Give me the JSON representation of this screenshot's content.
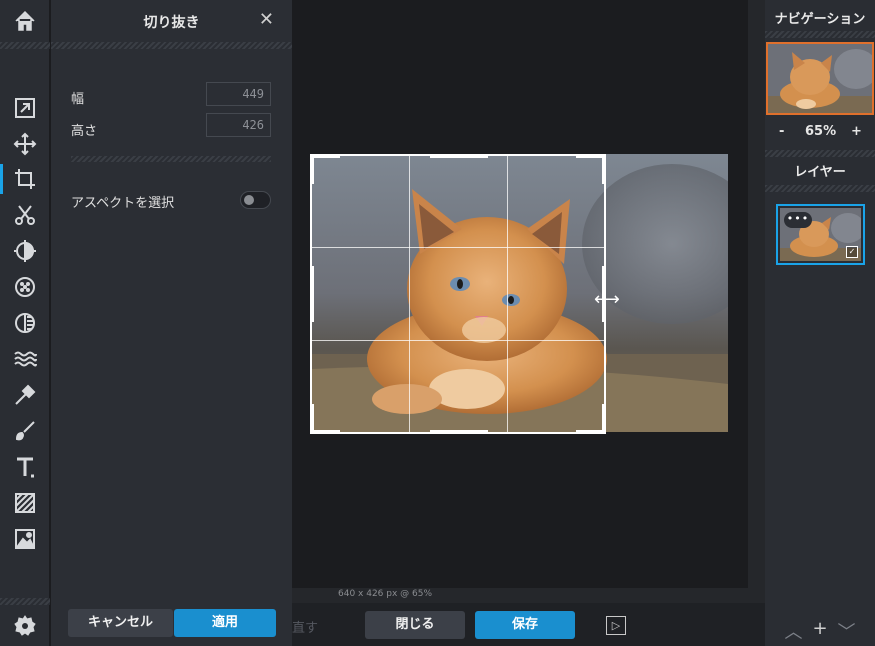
{
  "toolbar": {
    "icons": [
      "home-icon",
      "arrange-icon",
      "move-icon",
      "crop-icon",
      "cut-icon",
      "adjust-icon",
      "filter-icon",
      "effect-icon",
      "liquify-icon",
      "eyedropper-icon",
      "brush-icon",
      "text-icon",
      "pattern-icon",
      "image-icon",
      "settings-icon"
    ],
    "active": "crop-icon",
    "accent": "#1aa3e8"
  },
  "crop_panel": {
    "title": "切り抜き",
    "close": "✕",
    "width_label": "幅",
    "width_value": "449",
    "height_label": "高さ",
    "height_value": "426",
    "aspect_label": "アスペクトを選択",
    "aspect_enabled": false,
    "cancel_label": "キャンセル",
    "apply_label": "適用"
  },
  "canvas": {
    "status": "640 x 426 px @ 65%",
    "cursor": "⟷"
  },
  "bottom_bar": {
    "redo_label": "直す",
    "close_label": "閉じる",
    "save_label": "保存",
    "panel_toggle": "▷"
  },
  "right_panel": {
    "navigation_title": "ナビゲーション",
    "zoom_minus": "-",
    "zoom_value": "65%",
    "zoom_plus": "+",
    "layers_title": "レイヤー",
    "layer_menu": "•••",
    "layer_check": "✓",
    "bottom_up": "︿",
    "bottom_add": "+",
    "bottom_down": "﹀"
  },
  "colors": {
    "accent_blue": "#1a8fcf",
    "nav_border": "#e0702c",
    "panel_bg": "#2b2e34"
  }
}
